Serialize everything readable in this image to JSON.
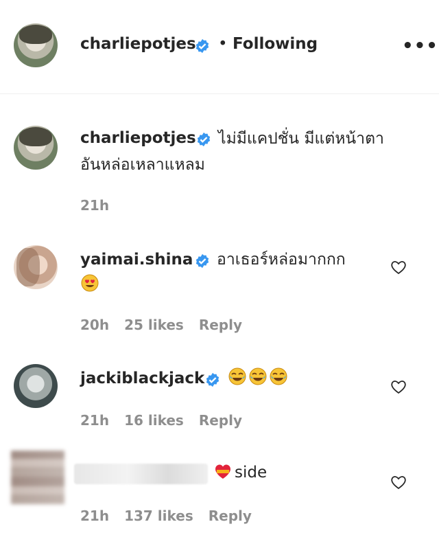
{
  "header": {
    "username": "charliepotjes",
    "separator": "•",
    "follow_state": "Following",
    "more_label": "•••"
  },
  "caption": {
    "username": "charliepotjes",
    "text_line1": "ไม่มีแคปชั่น มีแต่หน้าตา",
    "text_line2": "อันหล่อเหลาแหลม",
    "time": "21h"
  },
  "comments": [
    {
      "username": "yaimai.shina",
      "text": "อาเธอร์หล่อมากกก",
      "time": "20h",
      "likes": "25 likes",
      "reply": "Reply"
    },
    {
      "username": "jackiblackjack",
      "time": "21h",
      "likes": "16 likes",
      "reply": "Reply"
    },
    {
      "text": "side",
      "time": "21h",
      "likes": "137 likes",
      "reply": "Reply"
    }
  ],
  "icons": {
    "verified": "verified-badge-icon",
    "heart": "heart-outline-icon",
    "more": "more-options-icon"
  },
  "colors": {
    "verified_blue": "#3897f0",
    "meta_gray": "#8e8e8e",
    "text": "#262626"
  }
}
